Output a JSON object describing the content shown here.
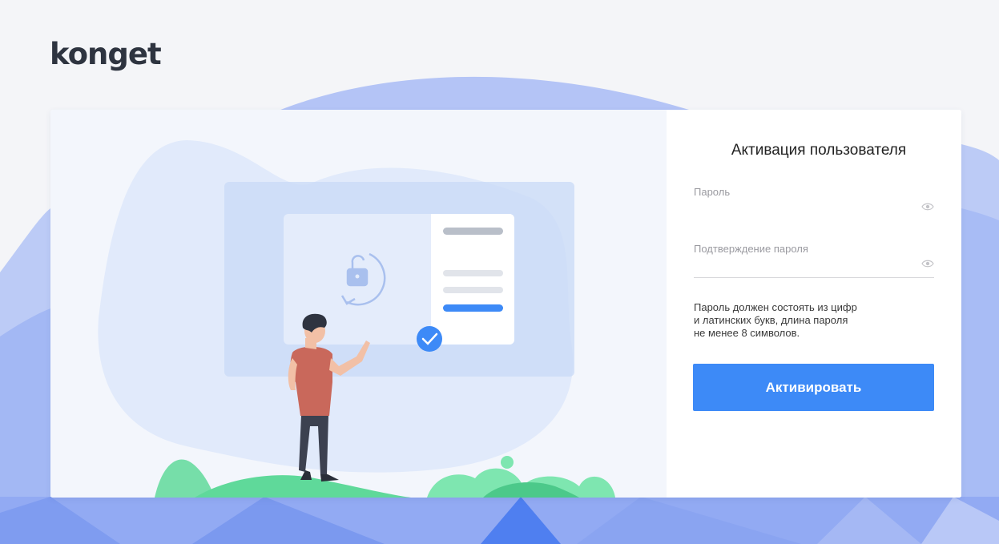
{
  "brand": {
    "logo_text": "konget"
  },
  "form": {
    "title": "Активация пользователя",
    "password_label": "Пароль",
    "password_value": "",
    "confirm_label": "Подтверждение пароля",
    "confirm_value": "",
    "hint_lines": [
      "Пароль должен состоять из цифр",
      "и латинских букв, длина пароля",
      "не менее 8 символов."
    ],
    "submit_label": "Активировать"
  },
  "icons": {
    "password_toggle": "eye-icon",
    "confirm_toggle": "eye-icon",
    "lock": "unlock-icon",
    "success": "checkmark-icon"
  },
  "colors": {
    "accent": "#3d8af7",
    "background_wave": "#b9c8f7",
    "background_wave_dark": "#7d9ef1",
    "grass": "#5fd99a",
    "text_primary": "#222222",
    "text_muted": "#9a9aa0"
  }
}
